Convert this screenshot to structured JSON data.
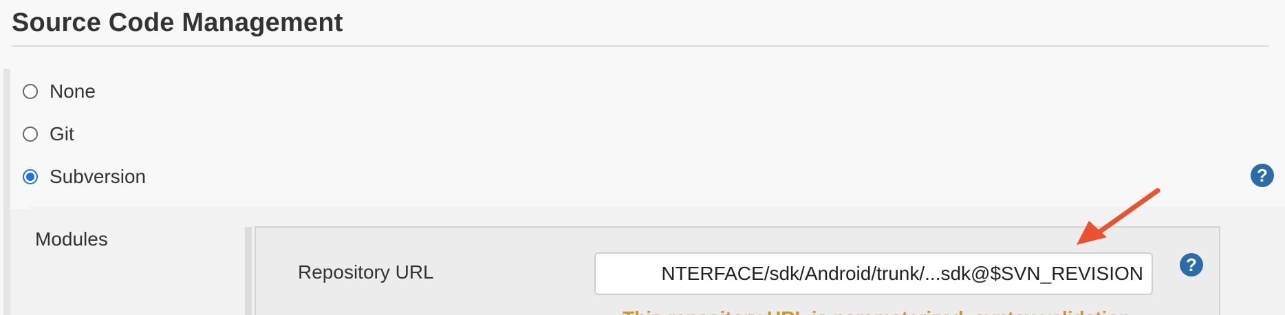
{
  "section": {
    "title": "Source Code Management"
  },
  "scm_options": [
    {
      "label": "None",
      "checked": false
    },
    {
      "label": "Git",
      "checked": false
    },
    {
      "label": "Subversion",
      "checked": true
    }
  ],
  "help": {
    "glyph": "?"
  },
  "modules": {
    "label": "Modules",
    "repository_url_label": "Repository URL",
    "repository_url_value": "NTERFACE/sdk/Android/trunk/...sdk@$SVN_REVISION",
    "warning": "This repository URL is parameterized, syntax validation"
  },
  "colors": {
    "accent": "#1a73e8",
    "help_icon": "#2a6ca8",
    "warning": "#d4932a",
    "annotation_arrow": "#e8522e"
  },
  "icons": [
    "help-icon",
    "arrow-annotation"
  ]
}
